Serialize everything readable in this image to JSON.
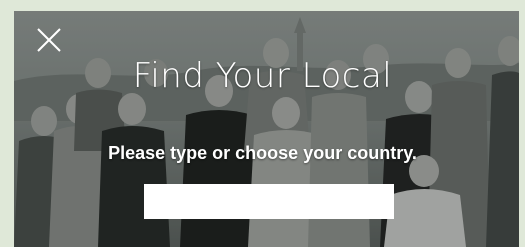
{
  "modal": {
    "title": "Find Your Local",
    "subtitle": "Please type or choose your country.",
    "close_icon": "close-icon",
    "country_input": {
      "value": "",
      "placeholder": ""
    }
  },
  "background": {
    "image": "group-photo"
  }
}
